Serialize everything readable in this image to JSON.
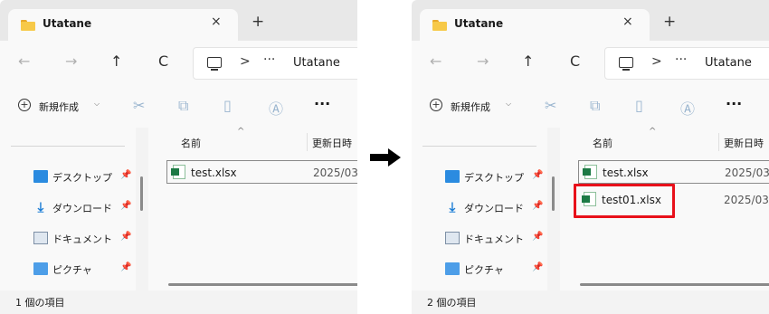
{
  "arrow_icon": "right-arrow-icon",
  "highlight_color": "#e8101a",
  "panels": [
    {
      "tab": {
        "title": "Utatane",
        "close": "×",
        "new_tab": "+"
      },
      "nav": {
        "back": "←",
        "forward": "→",
        "up": "↑",
        "refresh": "C"
      },
      "address": {
        "separator": ">",
        "more": "···",
        "current": "Utatane"
      },
      "toolbar": {
        "new_label": "新規作成",
        "new_caret": "⌵",
        "more": "···"
      },
      "sidebar": [
        {
          "label": "デスクトップ",
          "pin": "📌"
        },
        {
          "label": "ダウンロード",
          "pin": "📌"
        },
        {
          "label": "ドキュメント",
          "pin": "📌"
        },
        {
          "label": "ピクチャ",
          "pin": "📌"
        }
      ],
      "columns": {
        "name": "名前",
        "date": "更新日時"
      },
      "files": [
        {
          "name": "test.xlsx",
          "date": "2025/03/"
        }
      ],
      "status": "1 個の項目"
    },
    {
      "tab": {
        "title": "Utatane",
        "close": "×",
        "new_tab": "+"
      },
      "nav": {
        "back": "←",
        "forward": "→",
        "up": "↑",
        "refresh": "C"
      },
      "address": {
        "separator": ">",
        "more": "···",
        "current": "Utatane"
      },
      "toolbar": {
        "new_label": "新規作成",
        "new_caret": "⌵",
        "more": "···"
      },
      "sidebar": [
        {
          "label": "デスクトップ",
          "pin": "📌"
        },
        {
          "label": "ダウンロード",
          "pin": "📌"
        },
        {
          "label": "ドキュメント",
          "pin": "📌"
        },
        {
          "label": "ピクチャ",
          "pin": "📌"
        }
      ],
      "columns": {
        "name": "名前",
        "date": "更新日時"
      },
      "files": [
        {
          "name": "test.xlsx",
          "date": "2025/03/"
        },
        {
          "name": "test01.xlsx",
          "date": "2025/03/"
        }
      ],
      "status": "2 個の項目"
    }
  ]
}
